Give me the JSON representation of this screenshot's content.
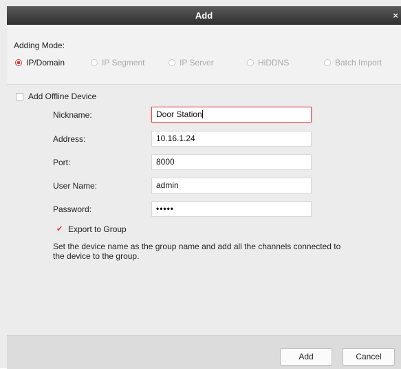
{
  "window": {
    "title": "Add",
    "close_glyph": "×"
  },
  "mode": {
    "label": "Adding Mode:",
    "options": [
      {
        "label": "IP/Domain",
        "selected": true
      },
      {
        "label": "IP Segment",
        "selected": false
      },
      {
        "label": "IP Server",
        "selected": false
      },
      {
        "label": "HiDDNS",
        "selected": false
      },
      {
        "label": "Batch Import",
        "selected": false
      }
    ]
  },
  "offline": {
    "label": "Add Offline Device",
    "checked": false
  },
  "form": {
    "nickname": {
      "label": "Nickname:",
      "value": "Door Station"
    },
    "address": {
      "label": "Address:",
      "value": "10.16.1.24"
    },
    "port": {
      "label": "Port:",
      "value": "8000"
    },
    "username": {
      "label": "User Name:",
      "value": "admin"
    },
    "password": {
      "label": "Password:",
      "value": "•••••"
    }
  },
  "export": {
    "label": "Export to Group",
    "checked": true,
    "hint": "Set the device name as the group name and add all the channels connected to the device to the group."
  },
  "buttons": {
    "add": "Add",
    "cancel": "Cancel"
  },
  "colors": {
    "accent": "#e03131",
    "titlebar": "#3a3a3a"
  }
}
